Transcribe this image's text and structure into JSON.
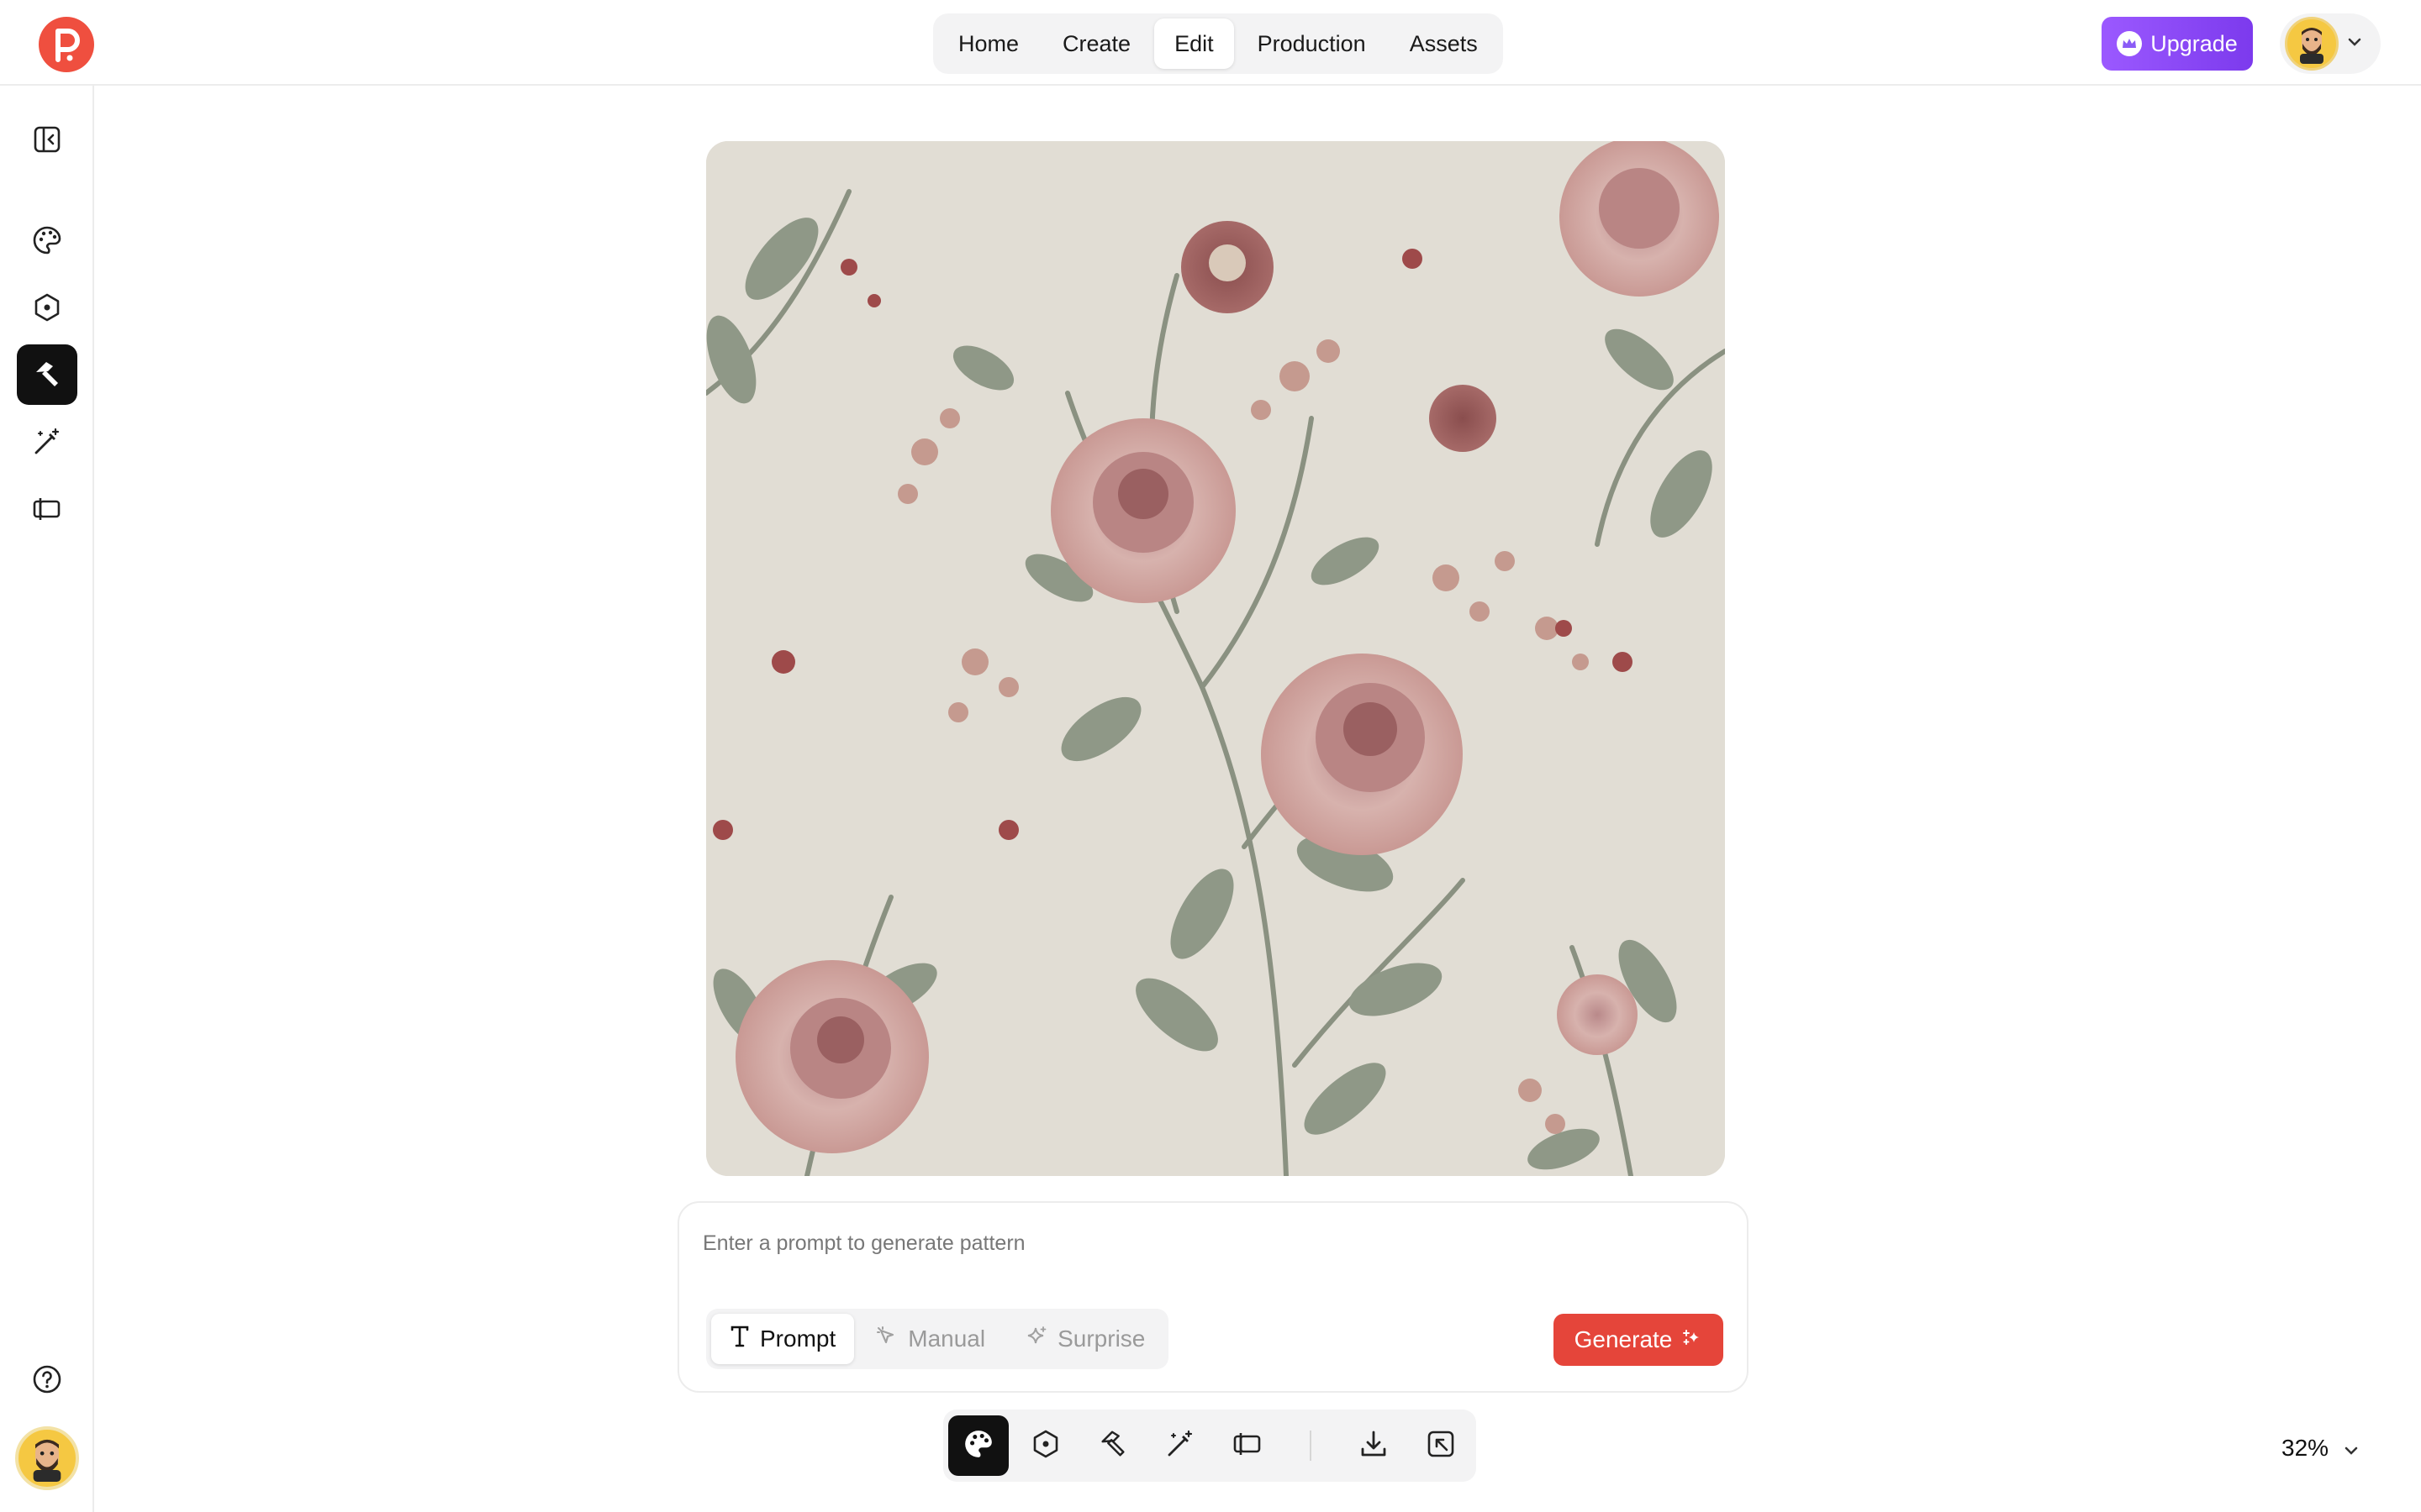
{
  "nav": {
    "items": [
      {
        "label": "Home",
        "active": false
      },
      {
        "label": "Create",
        "active": false
      },
      {
        "label": "Edit",
        "active": true
      },
      {
        "label": "Production",
        "active": false
      },
      {
        "label": "Assets",
        "active": false
      }
    ]
  },
  "header": {
    "upgrade_label": "Upgrade",
    "logo_icon": "p-logo-icon",
    "accent_color": "#ef4f3f",
    "upgrade_color": "#8b5cf6"
  },
  "sidebar": {
    "items": [
      {
        "icon": "collapse-sidebar-icon"
      },
      {
        "icon": "palette-icon"
      },
      {
        "icon": "hexagon-icon"
      },
      {
        "icon": "hammer-icon",
        "active": true
      },
      {
        "icon": "magic-wand-icon"
      },
      {
        "icon": "repeat-pattern-icon"
      }
    ],
    "help_icon": "help-icon"
  },
  "prompt": {
    "placeholder": "Enter a prompt to generate pattern",
    "value": "",
    "modes": [
      {
        "label": "Prompt",
        "icon": "text-t-icon",
        "active": true
      },
      {
        "label": "Manual",
        "icon": "pointer-icon",
        "active": false
      },
      {
        "label": "Surprise",
        "icon": "sparkle-icon",
        "active": false
      }
    ],
    "generate_label": "Generate"
  },
  "toolbar": {
    "tools": [
      "palette-icon",
      "hexagon-icon",
      "hammer-icon",
      "magic-wand-icon",
      "repeat-pattern-icon"
    ],
    "actions": [
      "download-icon",
      "export-icon"
    ]
  },
  "zoom": {
    "value": "32%"
  }
}
